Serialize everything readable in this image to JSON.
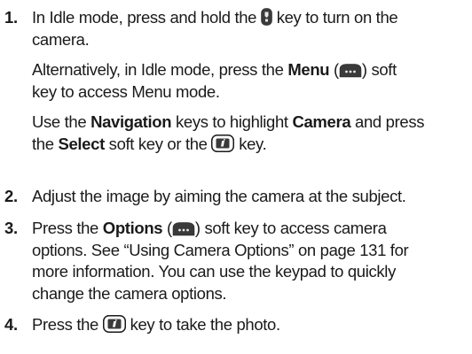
{
  "steps": [
    {
      "number": "1.",
      "paragraphs": [
        {
          "lines": [
            {
              "t1": "In Idle mode, press and hold the ",
              "t2": " key to turn on the"
            },
            {
              "t1": "camera."
            }
          ]
        },
        {
          "lines": [
            {
              "t1": "Alternatively, in Idle mode, press the ",
              "b1": "Menu",
              "t2": " (",
              "t3": ") soft"
            },
            {
              "t1": "key to access Menu mode."
            }
          ]
        },
        {
          "lines": [
            {
              "t1": "Use the ",
              "b1": "Navigation",
              "t2": " keys to highlight ",
              "b2": "Camera",
              "t3": " and press"
            },
            {
              "t1": "the ",
              "b1": "Select",
              "t2": " soft key or the ",
              "t3": " key."
            }
          ]
        }
      ]
    },
    {
      "number": "2.",
      "lines": [
        {
          "t1": "Adjust the image by aiming the camera at the subject."
        }
      ]
    },
    {
      "number": "3.",
      "lines": [
        {
          "t1": "Press the ",
          "b1": "Options",
          "t2": " (",
          "t3": ") soft key to access camera"
        },
        {
          "t1": "options. See “Using Camera Options” on page 131 for"
        },
        {
          "t1": "more information. You can use the keypad to quickly"
        },
        {
          "t1": "change the camera options."
        }
      ]
    },
    {
      "number": "4.",
      "lines": [
        {
          "t1": "Press the ",
          "t2": " key to take the photo."
        }
      ]
    }
  ],
  "icons": {
    "camera_key": "camera-key-icon",
    "soft_key": "soft-key-icon",
    "ok_key": "ok-key-icon"
  },
  "colors": {
    "text": "#1a1a1a",
    "key_fill": "#3a3a3a",
    "key_highlight": "#e8e8e8"
  }
}
